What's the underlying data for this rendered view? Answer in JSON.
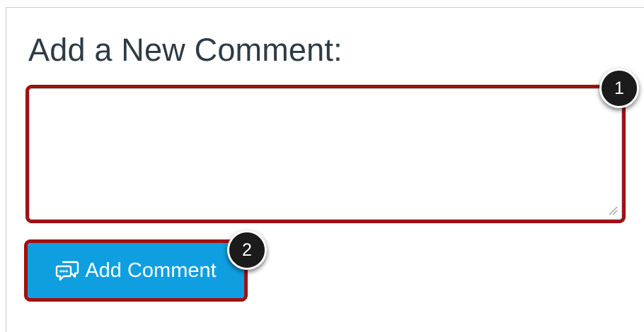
{
  "comment_form": {
    "heading": "Add a New Comment:",
    "textarea": {
      "value": "",
      "placeholder": ""
    },
    "add_button": {
      "label": "Add Comment",
      "icon": "comments-icon",
      "color": "#0f9fe0"
    }
  },
  "callouts": [
    {
      "number": "1",
      "target": "comment-textarea"
    },
    {
      "number": "2",
      "target": "add-comment-button"
    }
  ],
  "colors": {
    "highlight_border": "#9e1111",
    "callout_background": "#1b1b1b",
    "heading_text": "#2d3b45"
  }
}
